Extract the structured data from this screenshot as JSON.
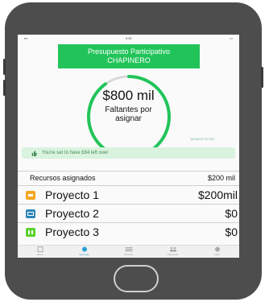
{
  "status_bar": {
    "time": "9:30"
  },
  "header": {
    "title_line1": "Presupuesto Participativo",
    "title_line2": "CHAPINERO"
  },
  "budget": {
    "amount": "$800 mil",
    "subtitle_line1": "Faltantes por",
    "subtitle_line2": "asignar",
    "note": "18 DAYS TO GO",
    "fill_fraction": 0.9,
    "ring_color": "#22c45a",
    "ring_track_color": "#d8d8d8"
  },
  "info_banner": {
    "text": "You're set to have £84 left over"
  },
  "summary": {
    "label": "Recursos asignados",
    "value": "$200 mil"
  },
  "projects": [
    {
      "name": "Proyecto 1",
      "amount": "$200mil",
      "color": "#f5a623",
      "icon": "folder-icon"
    },
    {
      "name": "Proyecto 2",
      "amount": "$0",
      "color": "#2b86b8",
      "icon": "card-icon"
    },
    {
      "name": "Proyecto 3",
      "amount": "$0",
      "color": "#5ad12a",
      "icon": "grid-icon"
    }
  ],
  "tabs": [
    {
      "label": "Home",
      "icon": "home-icon"
    },
    {
      "label": "Summary",
      "icon": "pie-chart-icon",
      "active": true
    },
    {
      "label": "Account",
      "icon": "list-icon"
    },
    {
      "label": "Payments",
      "icon": "people-icon"
    },
    {
      "label": "Help",
      "icon": "help-icon"
    }
  ]
}
